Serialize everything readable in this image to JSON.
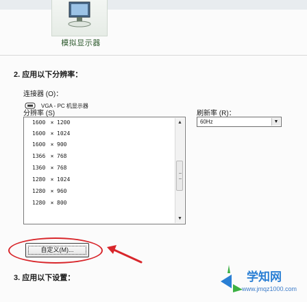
{
  "header": {
    "monitor_label": "模拟显示器"
  },
  "step2": {
    "title": "2. 应用以下分辨率：",
    "connector_label": "连接器 (O)：",
    "connector_value": "VGA - PC 机显示器",
    "resolution_label": "分辨率 (S)",
    "refresh_label": "刷新率 (R)：",
    "refresh_value": "60Hz",
    "resolutions": [
      {
        "w": "1600",
        "x": "×",
        "h": "1200"
      },
      {
        "w": "1600",
        "x": "×",
        "h": "1024"
      },
      {
        "w": "1600",
        "x": "×",
        "h": "900"
      },
      {
        "w": "1366",
        "x": "×",
        "h": "768"
      },
      {
        "w": "1360",
        "x": "×",
        "h": "768"
      },
      {
        "w": "1280",
        "x": "×",
        "h": "1024"
      },
      {
        "w": "1280",
        "x": "×",
        "h": "960"
      },
      {
        "w": "1280",
        "x": "×",
        "h": "800"
      }
    ],
    "custom_button": "自定义(M)..."
  },
  "step3": {
    "title": "3. 应用以下设置："
  },
  "watermark": {
    "name": "学知网",
    "url": "www.jmqz1000.com"
  },
  "colors": {
    "highlight": "#d8262b",
    "watermark": "#2a7fd4",
    "accent_green": "#2f5b2f"
  },
  "icons": [
    "monitor-icon",
    "connector-icon",
    "scroll-up-icon",
    "scroll-down-icon",
    "dropdown-arrow-icon",
    "annotation-arrow-icon",
    "watermark-logo-icon"
  ]
}
